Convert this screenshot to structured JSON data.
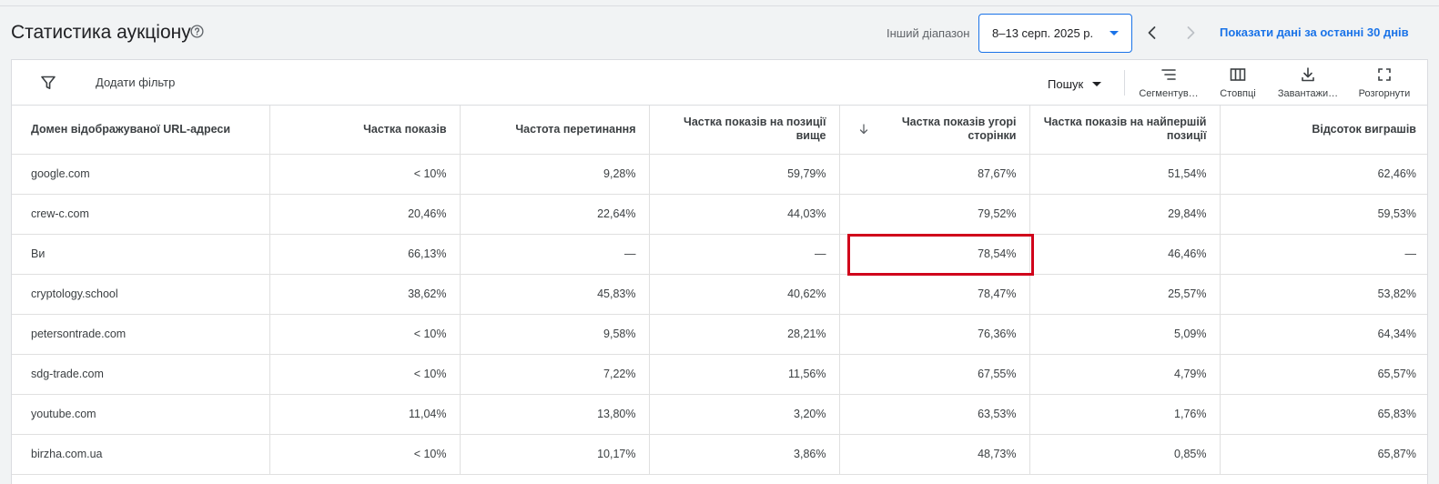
{
  "header": {
    "title": "Статистика аукціону",
    "range_label": "Інший діапазон",
    "date_range": "8–13 серп. 2025 р.",
    "last30_link": "Показати дані за останні 30 днів"
  },
  "toolbar": {
    "add_filter": "Додати фільтр",
    "search_select": "Пошук",
    "segment_label": "Сегментув…",
    "columns_label": "Стовпці",
    "download_label": "Завантажи…",
    "expand_label": "Розгорнути"
  },
  "table": {
    "columns": [
      "Домен відображуваної URL-адреси",
      "Частка показів",
      "Частота перетинання",
      "Частка показів на позиції вище",
      "Частка показів угорі сторінки",
      "Частка показів на найпершій позиції",
      "Відсоток виграшів"
    ],
    "rows": [
      [
        "google.com",
        "< 10%",
        "9,28%",
        "59,79%",
        "87,67%",
        "51,54%",
        "62,46%"
      ],
      [
        "crew-c.com",
        "20,46%",
        "22,64%",
        "44,03%",
        "79,52%",
        "29,84%",
        "59,53%"
      ],
      [
        "Ви",
        "66,13%",
        "—",
        "—",
        "78,54%",
        "46,46%",
        "—"
      ],
      [
        "cryptology.school",
        "38,62%",
        "45,83%",
        "40,62%",
        "78,47%",
        "25,57%",
        "53,82%"
      ],
      [
        "petersontrade.com",
        "< 10%",
        "9,58%",
        "28,21%",
        "76,36%",
        "5,09%",
        "64,34%"
      ],
      [
        "sdg-trade.com",
        "< 10%",
        "7,22%",
        "11,56%",
        "67,55%",
        "4,79%",
        "65,57%"
      ],
      [
        "youtube.com",
        "11,04%",
        "13,80%",
        "3,20%",
        "63,53%",
        "1,76%",
        "65,83%"
      ],
      [
        "birzha.com.ua",
        "< 10%",
        "10,17%",
        "3,86%",
        "48,73%",
        "0,85%",
        "65,87%"
      ]
    ]
  },
  "icons": {
    "help": "help-circle-icon",
    "caret": "caret-down-icon",
    "prev": "chevron-left-icon",
    "next": "chevron-right-icon",
    "filter": "filter-icon",
    "segment": "segment-icon",
    "columns": "columns-icon",
    "download": "download-icon",
    "expand": "expand-icon",
    "sort": "arrow-down-icon"
  },
  "colors": {
    "accent": "#1a73e8",
    "highlight": "#d0021b"
  }
}
